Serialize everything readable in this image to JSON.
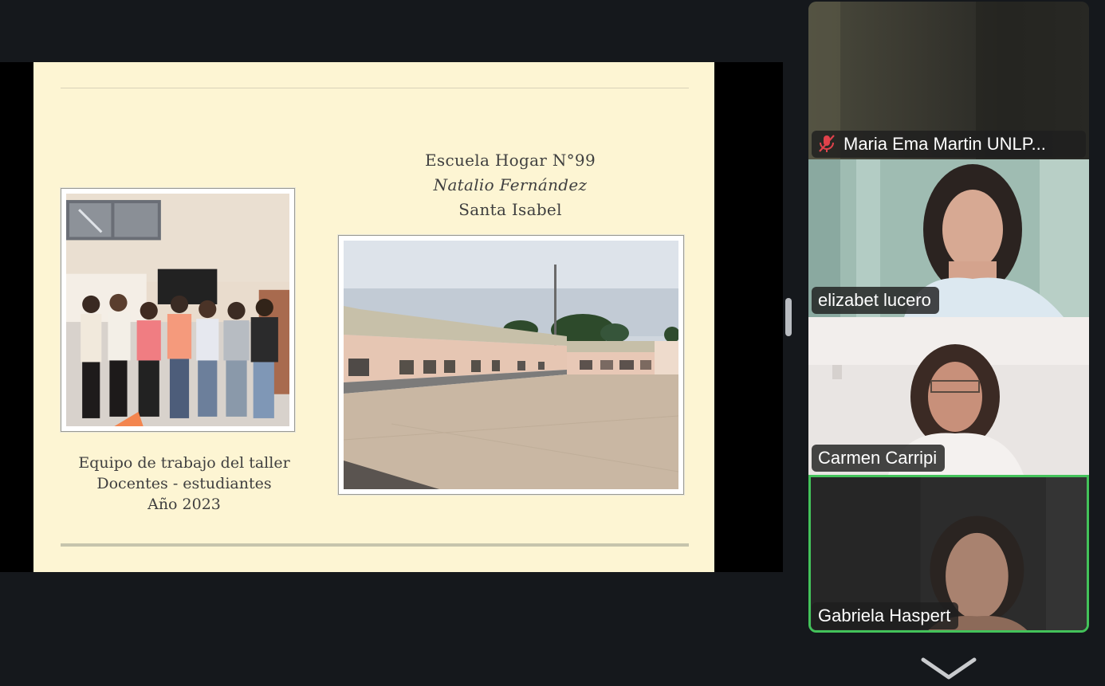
{
  "slide": {
    "school_line1": "Escuela Hogar N°99",
    "school_line2": "Natalio Fernández",
    "school_line3": "Santa Isabel",
    "caption_line1": "Equipo de trabajo del taller",
    "caption_line2": "Docentes - estudiantes",
    "caption_line3": "Año 2023"
  },
  "participants": [
    {
      "name": "Maria Ema Martin UNLP...",
      "muted": true,
      "icon": "mic-muted-icon"
    },
    {
      "name": "elizabet lucero"
    },
    {
      "name": "Carmen Carripi"
    },
    {
      "name": "Gabriela Haspert",
      "active_speaker": true
    }
  ],
  "colors": {
    "slide_bg": "#fdf5d3",
    "active_speaker_border": "#43c25a",
    "muted_icon": "#e0424b",
    "app_bg": "#15181c"
  },
  "controls": {
    "more_participants_icon": "chevron-down-icon"
  }
}
